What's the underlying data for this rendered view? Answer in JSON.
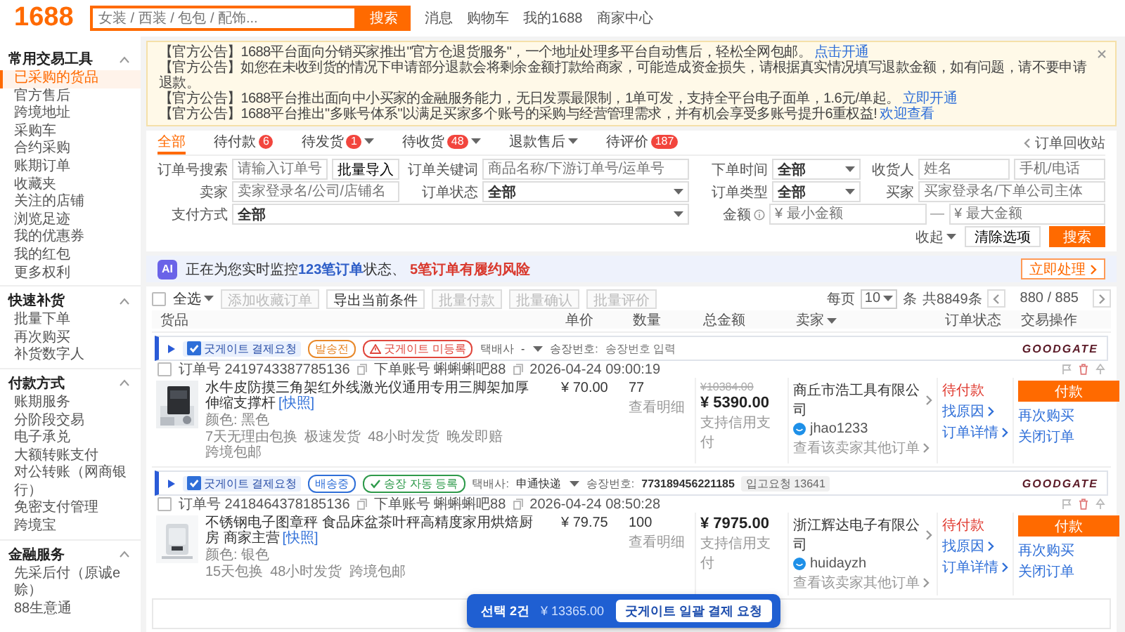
{
  "topbar": {
    "logo": "1688",
    "search": {
      "placeholder": "女装 / 西装 / 包包 / 配饰..."
    },
    "search_button": "搜索",
    "links": [
      "消息",
      "购物车",
      "我的1688",
      "商家中心"
    ]
  },
  "notices": [
    {
      "text": "【官方公告】1688平台面向分销买家推出\"官方仓退货服务\"，一个地址处理多平台自动售后，轻松全网包邮。",
      "link": "点击开通"
    },
    {
      "text": "【官方公告】如您在未收到货的情况下申请部分退款会将剩余金额打款给商家，可能造成资金损失，请根据真实情况填写退款金额，如有问题，请不要申请退款。"
    },
    {
      "text": "【官方公告】1688平台推出面向中小买家的金融服务能力，无日发票最限制，1单可发，支持全平台电子面单，1.6元/单起。",
      "link": "立即开通"
    },
    {
      "text": "【官方公告】1688平台推出\"多账号体系\"以满足买家多个账号的采购与经营管理需求，并有机会享受多账号提升6重权益!",
      "link": "欢迎查看"
    }
  ],
  "sidebar": [
    {
      "title": "常用交易工具",
      "expanded": true,
      "items": [
        {
          "label": "已采购的货品",
          "selected": true
        },
        {
          "label": "官方售后",
          "selected": false
        },
        {
          "label": "跨境地址",
          "selected": false
        },
        {
          "label": "采购车",
          "selected": false
        },
        {
          "label": "合约采购",
          "selected": false
        },
        {
          "label": "账期订单",
          "selected": false
        },
        {
          "label": "收藏夹",
          "selected": false
        },
        {
          "label": "关注的店铺",
          "selected": false
        },
        {
          "label": "浏览足迹",
          "selected": false
        },
        {
          "label": "我的优惠券",
          "selected": false
        },
        {
          "label": "我的红包",
          "selected": false
        },
        {
          "label": "更多权利",
          "selected": false
        }
      ]
    },
    {
      "title": "快速补货",
      "expanded": true,
      "items": [
        {
          "label": "批量下单",
          "selected": false
        },
        {
          "label": "再次购买",
          "selected": false
        },
        {
          "label": "补货数字人",
          "selected": false
        }
      ]
    },
    {
      "title": "付款方式",
      "expanded": true,
      "items": [
        {
          "label": "账期服务",
          "selected": false
        },
        {
          "label": "分阶段交易",
          "selected": false
        },
        {
          "label": "电子承兑",
          "selected": false
        },
        {
          "label": "大额转账支付",
          "selected": false
        },
        {
          "label": "对公转账（网商银行）",
          "selected": false
        },
        {
          "label": "免密支付管理",
          "selected": false
        },
        {
          "label": "跨境宝",
          "selected": false
        }
      ]
    },
    {
      "title": "金融服务",
      "expanded": true,
      "items": [
        {
          "label": "先采后付（原诚e赊）",
          "selected": false
        },
        {
          "label": "88生意通",
          "selected": false
        }
      ]
    }
  ],
  "tabs": [
    {
      "label": "全部",
      "selected": true,
      "dropdown": false
    },
    {
      "label": "待付款",
      "badge": "6",
      "selected": false,
      "dropdown": false
    },
    {
      "label": "待发货",
      "badge": "1",
      "selected": false,
      "dropdown": true
    },
    {
      "label": "待收货",
      "badge": "48",
      "selected": false,
      "dropdown": true
    },
    {
      "label": "退款售后",
      "selected": false,
      "dropdown": true
    },
    {
      "label": "待评价",
      "badge": "187",
      "selected": false,
      "dropdown": false
    }
  ],
  "recycle_bin": "订单回收站",
  "filter_rows": [
    [
      {
        "label": "订单号搜索",
        "info": false,
        "controls": [
          {
            "kind": "input",
            "placeholder": "请输入订单号"
          },
          {
            "kind": "button",
            "label": "批量导入"
          }
        ]
      },
      {
        "label": "订单关键词",
        "info": false,
        "controls": [
          {
            "kind": "input",
            "placeholder": "商品名称/下游订单号/运单号"
          }
        ]
      },
      {
        "label": "下单时间",
        "info": false,
        "controls": [
          {
            "kind": "select",
            "value": "全部"
          }
        ]
      },
      {
        "label": "收货人",
        "info": false,
        "controls": [
          {
            "kind": "input",
            "placeholder": "姓名"
          },
          {
            "kind": "input",
            "placeholder": "手机/电话"
          }
        ]
      }
    ],
    [
      {
        "label": "卖家",
        "info": false,
        "controls": [
          {
            "kind": "input",
            "placeholder": "卖家登录名/公司/店铺名"
          }
        ]
      },
      {
        "label": "订单状态",
        "info": false,
        "controls": [
          {
            "kind": "select",
            "value": "全部"
          }
        ]
      },
      {
        "label": "订单类型",
        "info": false,
        "controls": [
          {
            "kind": "select",
            "value": "全部"
          }
        ]
      },
      {
        "label": "买家",
        "info": false,
        "controls": [
          {
            "kind": "input",
            "placeholder": "买家登录名/下单公司主体"
          }
        ]
      }
    ],
    [
      {
        "label": "支付方式",
        "info": false,
        "controls": [
          {
            "kind": "select",
            "value": "全部"
          }
        ]
      },
      {
        "label": "金额",
        "info": true,
        "controls": [
          {
            "kind": "input",
            "placeholder": "¥ 最小金额"
          },
          {
            "kind": "separator",
            "text": "—"
          },
          {
            "kind": "input",
            "placeholder": "¥ 最大金额"
          }
        ]
      }
    ]
  ],
  "filter_actions": {
    "collapse": "收起",
    "clear": "清除选项",
    "search": "搜索"
  },
  "ai_bar": {
    "badge": "AI",
    "message": "正在为您实时监控**123笔订单**状态、 **5笔订单有履约风险**",
    "action": "立即处理"
  },
  "toolbar": {
    "select_all": {
      "label": "全选",
      "checked": false
    },
    "buttons": [
      {
        "label": "添加收藏订单",
        "disabled": true
      },
      {
        "label": "导出当前条件",
        "disabled": false
      },
      {
        "label": "批量付款",
        "disabled": true
      },
      {
        "label": "批量确认",
        "disabled": true
      },
      {
        "label": "批量评价",
        "disabled": true
      }
    ],
    "per_page_label": "每页",
    "per_page": "10",
    "unit": "条",
    "total": "共8849条",
    "page": "880 / 885"
  },
  "columns": [
    {
      "label": "货品",
      "dropdown": false
    },
    {
      "label": "单价",
      "dropdown": false
    },
    {
      "label": "数量",
      "dropdown": false
    },
    {
      "label": "总金额",
      "dropdown": false
    },
    {
      "label": "卖家",
      "dropdown": true
    },
    {
      "label": "订单状态",
      "dropdown": false
    },
    {
      "label": "交易操作",
      "dropdown": false
    }
  ],
  "orders": [
    {
      "expanded": false,
      "request": {
        "label": "굿게이트 결제요청",
        "checked": true
      },
      "tags": [
        {
          "text": "발송전",
          "kind": "plain",
          "color": "#e8892b"
        },
        {
          "text": "굿게이트 미등록",
          "kind": "warning",
          "color": "#e0463c"
        }
      ],
      "courier": {
        "label": "택배사",
        "value": "-"
      },
      "tracking": {
        "label": "송장번호:",
        "kind": "input",
        "placeholder": "송장번호 입력"
      },
      "brand": "GOODGATE",
      "selected": false,
      "order_no_label": "订单号",
      "order_no": "2419743387785136",
      "account_label": "下单账号",
      "account": "蝌蝌蝌吧88",
      "time": "2026-04-24 09:00:19",
      "item": {
        "title": "水牛皮防摸三角架红外线激光仪通用专用三脚架加厚伸缩支撑杆",
        "snapshot": "[快照]",
        "spec": "颜色: 黑色",
        "services": [
          "7天无理由包换",
          "极速发货",
          "48小时发货",
          "晚发即赔",
          "跨境包邮"
        ]
      },
      "unit_price": "¥ 70.00",
      "quantity": "77",
      "quantity_link": "查看明细",
      "original_total": "¥10384.00",
      "total": "¥ 5390.00",
      "payment_note": "支持信用支付",
      "seller": "商丘市浩工具有限公司",
      "seller_im": "jhao1233",
      "seller_orders": "查看该卖家其他订单",
      "status": "待付款",
      "status_links": [
        "找原因",
        "订单详情"
      ],
      "pay_button": "付款",
      "actions": [
        "再次购买",
        "关闭订单"
      ]
    },
    {
      "expanded": false,
      "request": {
        "label": "굿게이트 결제요청",
        "checked": true
      },
      "tags": [
        {
          "text": "배송중",
          "kind": "plain",
          "color": "#2f6fd8"
        },
        {
          "text": "송장 자동 등록",
          "kind": "check",
          "color": "#2e9a4b"
        }
      ],
      "courier": {
        "label": "택배사:",
        "value": "申通快递"
      },
      "tracking": {
        "label": "송장번호:",
        "kind": "text",
        "value": "773189456221185"
      },
      "inbound": {
        "label": "입고요청",
        "value": "13641"
      },
      "brand": "GOODGATE",
      "selected": false,
      "order_no_label": "订单号",
      "order_no": "2418464378185136",
      "account_label": "下单账号",
      "account": "蝌蝌蝌吧88",
      "time": "2026-04-24 08:50:28",
      "item": {
        "title": "不锈钢电子图章秤 食品床盆茶叶秤高精度家用烘焙厨房 商家主营",
        "snapshot": "[快照]",
        "spec": "颜色: 银色",
        "services": [
          "15天包换",
          "48小时发货",
          "跨境包邮"
        ]
      },
      "unit_price": "¥ 79.75",
      "quantity": "100",
      "quantity_link": "查看明细",
      "total": "¥ 7975.00",
      "payment_note": "支持信用支付",
      "seller": "浙江辉达电子有限公司",
      "seller_im": "huidayzh",
      "seller_orders": "查看该卖家其他订单",
      "status": "待付款",
      "status_links": [
        "找原因",
        "订单详情"
      ],
      "pay_button": "付款",
      "actions": [
        "再次购买",
        "关闭订单"
      ]
    }
  ],
  "selection_bar": {
    "count": "선택 2건",
    "amount": "¥ 13365.00",
    "button": "굿게이트 일괄 결제 요청"
  }
}
